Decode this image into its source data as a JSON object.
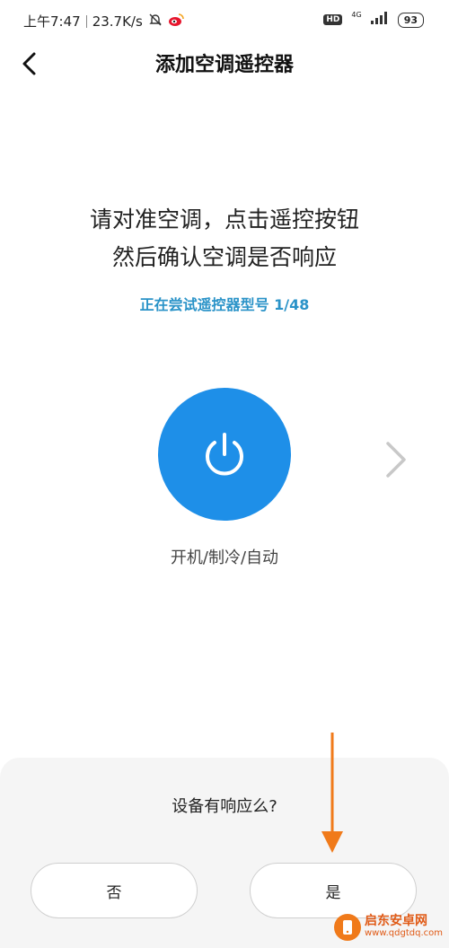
{
  "status_bar": {
    "time": "上午7:47",
    "speed": "23.7K/s",
    "hd": "HD",
    "network": "4G",
    "battery": "93"
  },
  "header": {
    "title": "添加空调遥控器",
    "back_icon": "chevron-left-icon"
  },
  "main": {
    "instruction_line1": "请对准空调，点击遥控按钮",
    "instruction_line2": "然后确认空调是否响应",
    "progress_text": "正在尝试遥控器型号 1/48",
    "power_icon": "power-icon",
    "next_icon": "chevron-right-icon",
    "function_label": "开机/制冷/自动"
  },
  "confirm": {
    "question": "设备有响应么?",
    "no_label": "否",
    "yes_label": "是"
  },
  "watermark": {
    "name": "启东安卓网",
    "url": "www.qdgtdq.com"
  },
  "colors": {
    "accent": "#1e8fe8",
    "progress_text": "#2a93c8",
    "annotation_arrow": "#f07a1a"
  }
}
